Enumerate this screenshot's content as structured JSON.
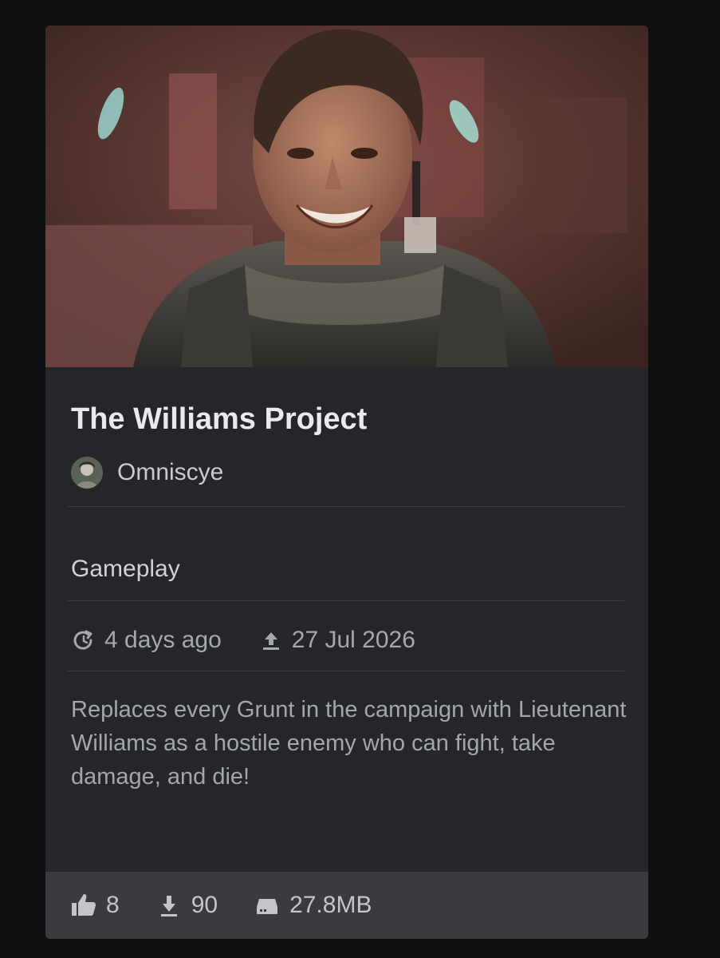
{
  "mod": {
    "title": "The Williams Project",
    "author": "Omniscye",
    "category": "Gameplay",
    "updated": "4 days ago",
    "uploaded": "27 Jul 2026",
    "description": "Replaces every Grunt in the campaign with Lieutenant Williams as a hostile enemy who can fight, take damage, and die!"
  },
  "stats": {
    "likes": "8",
    "downloads": "90",
    "size": "27.8MB"
  },
  "icons": {
    "updated": "refresh-clock-icon",
    "uploaded": "upload-icon",
    "likes": "thumbs-up-icon",
    "downloads": "download-icon",
    "size": "hard-drive-icon"
  },
  "colors": {
    "card_bg": "#25262a",
    "footer_bg": "#3a3b40",
    "title": "#e9eaec",
    "muted": "#a5a8ad"
  }
}
